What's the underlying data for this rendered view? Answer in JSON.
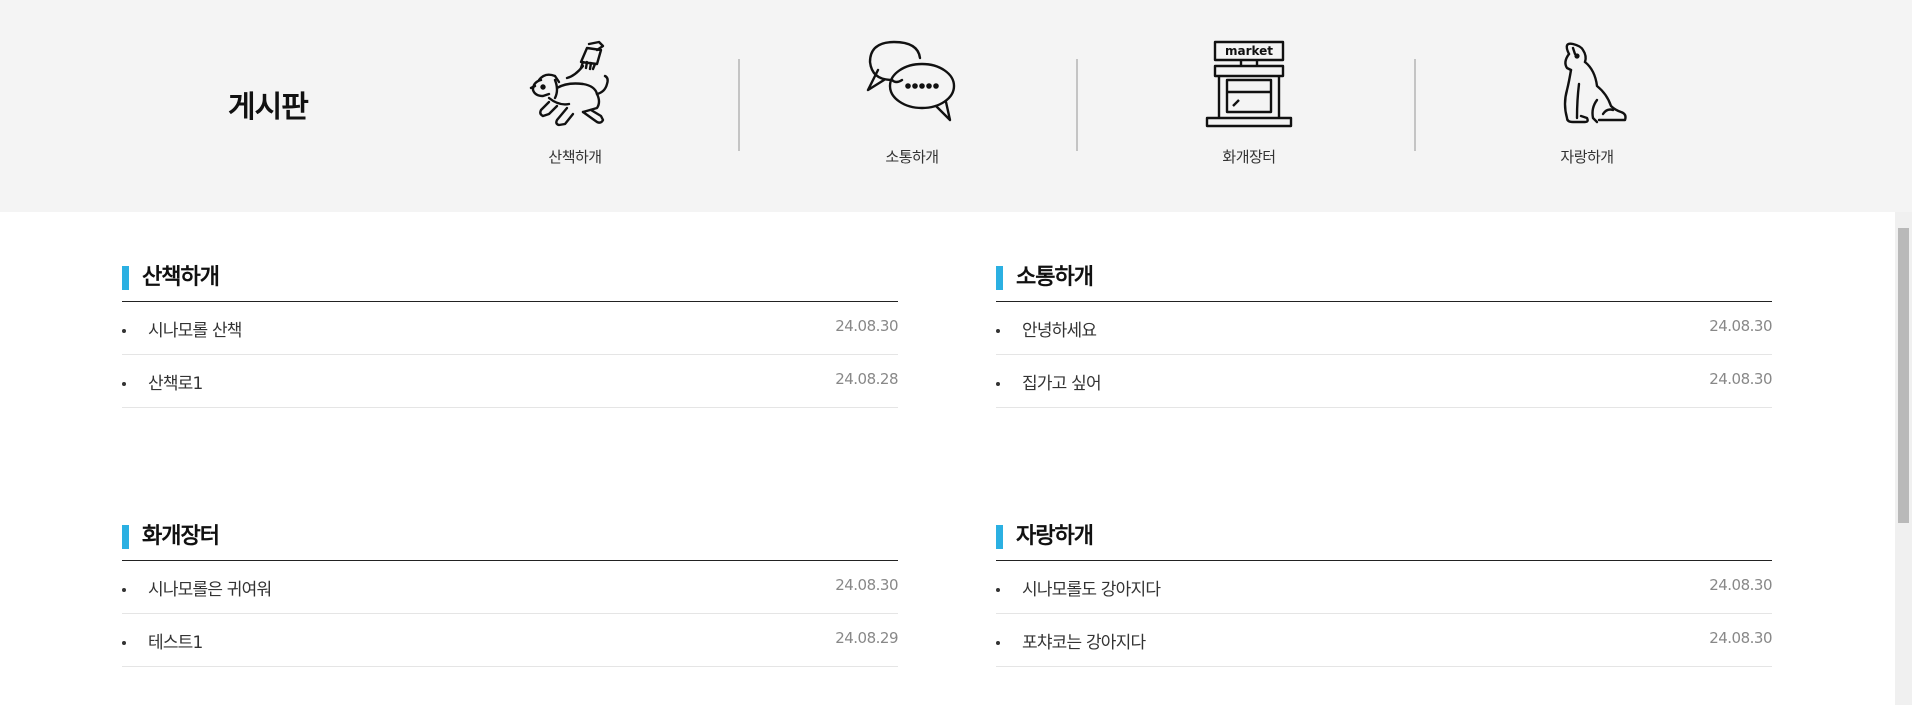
{
  "board": {
    "title": "게시판"
  },
  "categories": [
    {
      "label": "산책하개",
      "icon": "dog-walking-icon"
    },
    {
      "label": "소통하개",
      "icon": "chat-bubbles-icon"
    },
    {
      "label": "화개장터",
      "icon": "market-stall-icon",
      "sign": "market"
    },
    {
      "label": "자랑하개",
      "icon": "sitting-dog-icon"
    }
  ],
  "accent_color": "#2bb0e2",
  "sections": [
    {
      "title": "산책하개",
      "posts": [
        {
          "title": "시나모롤 산책",
          "date": "24.08.30"
        },
        {
          "title": "산책로1",
          "date": "24.08.28"
        }
      ]
    },
    {
      "title": "소통하개",
      "posts": [
        {
          "title": "안녕하세요",
          "date": "24.08.30"
        },
        {
          "title": "집가고 싶어",
          "date": "24.08.30"
        }
      ]
    },
    {
      "title": "화개장터",
      "posts": [
        {
          "title": "시나모롤은 귀여워",
          "date": "24.08.30"
        },
        {
          "title": "테스트1",
          "date": "24.08.29"
        }
      ]
    },
    {
      "title": "자랑하개",
      "posts": [
        {
          "title": "시나모롤도 강아지다",
          "date": "24.08.30"
        },
        {
          "title": "포챠코는 강아지다",
          "date": "24.08.30"
        }
      ]
    }
  ]
}
